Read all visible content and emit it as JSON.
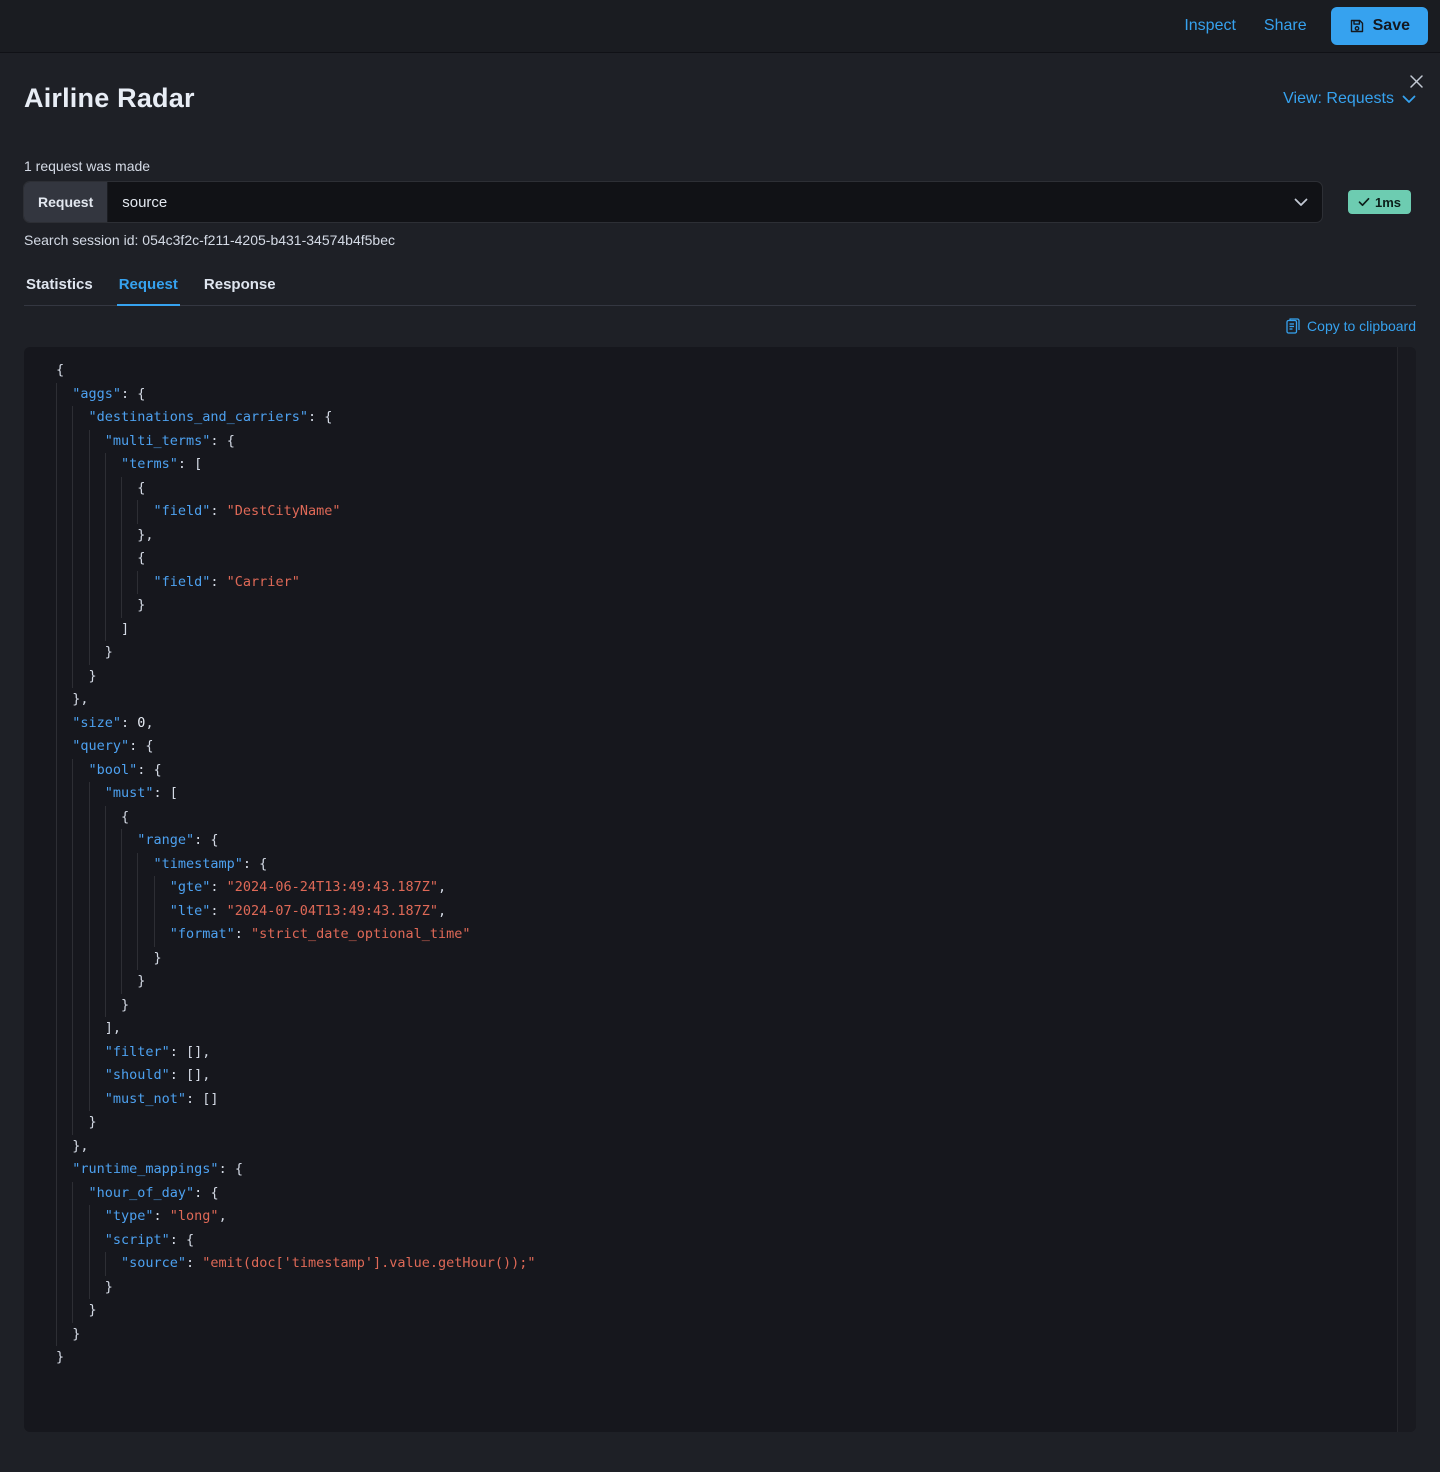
{
  "top_bar": {
    "inspect_label": "Inspect",
    "share_label": "Share",
    "save_label": "Save"
  },
  "flyout": {
    "title": "Airline Radar",
    "view_selector_label": "View: Requests",
    "requests_summary": "1 request was made",
    "request_field_label": "Request",
    "request_selected_option": "source",
    "request_time_badge": "1ms",
    "session_id_line": "Search session id: 054c3f2c-f211-4205-b431-34574b4f5bec",
    "tabs": [
      {
        "label": "Statistics",
        "active": false
      },
      {
        "label": "Request",
        "active": true
      },
      {
        "label": "Response",
        "active": false
      }
    ],
    "copy_button_label": "Copy to clipboard"
  },
  "request_body": {
    "aggs": {
      "destinations_and_carriers": {
        "multi_terms": {
          "terms": [
            {
              "field": "DestCityName"
            },
            {
              "field": "Carrier"
            }
          ]
        }
      }
    },
    "size": 0,
    "query": {
      "bool": {
        "must": [
          {
            "range": {
              "timestamp": {
                "gte": "2024-06-24T13:49:43.187Z",
                "lte": "2024-07-04T13:49:43.187Z",
                "format": "strict_date_optional_time"
              }
            }
          }
        ],
        "filter": [],
        "should": [],
        "must_not": []
      }
    },
    "runtime_mappings": {
      "hour_of_day": {
        "type": "long",
        "script": {
          "source": "emit(doc['timestamp'].value.getHour());"
        }
      }
    }
  },
  "colors": {
    "accent": "#36a2ef",
    "badge_success": "#6dccb1",
    "code_key": "#4da1f0",
    "code_string": "#df6957"
  }
}
